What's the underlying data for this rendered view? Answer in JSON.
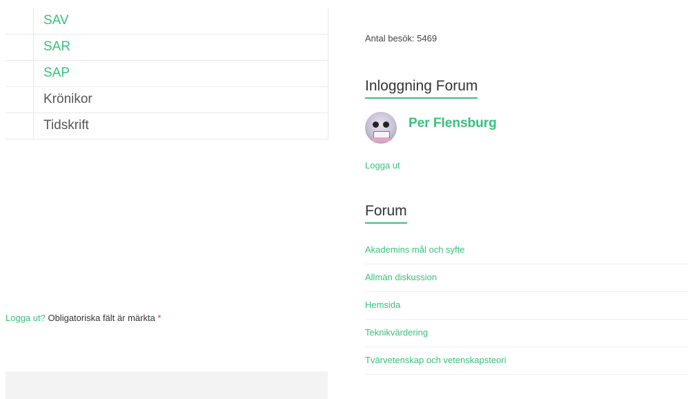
{
  "menu_table": {
    "rows": [
      {
        "label": "SAV",
        "is_link": true
      },
      {
        "label": "SAR",
        "is_link": true
      },
      {
        "label": "SAP",
        "is_link": true
      },
      {
        "label": "Krönikor",
        "is_link": false
      },
      {
        "label": "Tidskrift",
        "is_link": false
      }
    ]
  },
  "comment_form": {
    "logout_link": "Logga ut?",
    "required_note": "Obligatoriska fält är märkta",
    "required_marker": "*"
  },
  "sidebar": {
    "visit_count": "Antal besök: 5469",
    "login_widget": {
      "title": "Inloggning Forum",
      "user_name": "Per Flensburg",
      "avatar_icon": "avatar-icon",
      "logout_label": "Logga ut"
    },
    "forum_widget": {
      "title": "Forum",
      "items": [
        "Akademins mål och syfte",
        "Allmän diskussion",
        "Hemsida",
        "Teknikvärdering",
        "Tvärvetenskap och vetenskapsteori"
      ]
    }
  },
  "colors": {
    "accent": "#35c17c",
    "required": "#e0303a"
  }
}
